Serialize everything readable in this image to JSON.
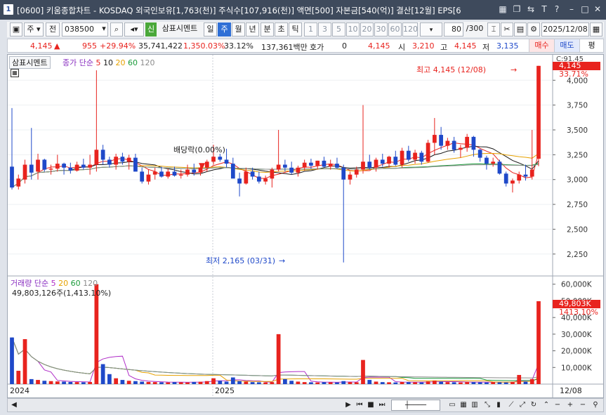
{
  "window": {
    "number": "1",
    "title": "[0600] 키움종합차트 - KOSDAQ 외국인보유[1,763(천)] 주식수[107,916(천)] 액면[500] 자본금[540(억)] 결산[12월] EPS[6"
  },
  "toolbar": {
    "market": "주",
    "prev": "전",
    "code": "038500",
    "credit": "신",
    "stock_name": "삼표시멘트",
    "periods": [
      "일",
      "주",
      "월",
      "년",
      "분",
      "초",
      "틱"
    ],
    "selected_period": "주",
    "intervals": [
      "1",
      "3",
      "5",
      "10",
      "20",
      "30",
      "60",
      "120"
    ],
    "count": "80",
    "total": "/300",
    "date": "2025/12/08"
  },
  "info": {
    "price": "4,145",
    "price_arrow": "▲",
    "change": "955",
    "change_pct": "+29.94%",
    "volume": "35,741,422",
    "volume_pct": "1,350.03%",
    "turnover": "33.12%",
    "amount": "137,361백만",
    "quote_label": "호가",
    "quote_value": "0",
    "quote_price": "4,145",
    "open_label": "시",
    "open": "3,210",
    "high_label": "고",
    "high": "4,145",
    "low_label": "저",
    "low": "3,135",
    "buy": "매수",
    "sell": "매도",
    "avg": "평"
  },
  "price_panel": {
    "name": "삼표시멘트",
    "ma_label": "종가 단순",
    "ma_periods": [
      "5",
      "10",
      "20",
      "60",
      "120"
    ],
    "ma_colors": [
      "#e8231e",
      "#1a1a1a",
      "#e6a100",
      "#1a9b3a",
      "#8c8c8c"
    ],
    "max_annotation": "최고 4,145 (12/08)",
    "min_annotation": "최저 2,165 (03/31)",
    "dividend_annotation": "배당락(0.00%)",
    "top_label": "C:91.45",
    "current_price": "4,145",
    "current_pct": "33.71%",
    "y_ticks": [
      "4,000",
      "3,750",
      "3,500",
      "3,250",
      "3,000",
      "2,750",
      "2,500",
      "2,250"
    ]
  },
  "volume_panel": {
    "name": "거래량",
    "ma_label": "단순",
    "ma_periods": [
      "5",
      "20",
      "60",
      "120"
    ],
    "ma_colors": [
      "#b02ec8",
      "#e6a100",
      "#1a9b3a",
      "#8c8c8c"
    ],
    "value_text": "49,803,126주(1,413.10%)",
    "current_value": "49,803K",
    "current_pct": "1413.10%",
    "y_ticks": [
      "60,000K",
      "50,000K",
      "40,000K",
      "30,000K",
      "20,000K",
      "10,000K"
    ]
  },
  "x_axis": {
    "labels": [
      "2024",
      "2025"
    ],
    "end_label": "12/08"
  },
  "chart_data": {
    "type": "candlestick",
    "x_labels": [
      "2024",
      "2025"
    ],
    "price_ylim": [
      2100,
      4200
    ],
    "volume_ylim": [
      0,
      62000
    ],
    "up_color": "#e8231e",
    "down_color": "#1f49c9",
    "candles": [
      [
        3130,
        3720,
        2900,
        2920
      ],
      [
        2930,
        3050,
        2900,
        3010
      ],
      [
        3000,
        3200,
        2960,
        3150
      ],
      [
        3150,
        3520,
        3000,
        3070
      ],
      [
        3080,
        3260,
        3000,
        3200
      ],
      [
        3200,
        3210,
        3080,
        3100
      ],
      [
        3100,
        3150,
        3050,
        3110
      ],
      [
        3110,
        3250,
        3080,
        3160
      ],
      [
        3160,
        3170,
        3050,
        3120
      ],
      [
        3120,
        3170,
        3060,
        3090
      ],
      [
        3090,
        3180,
        3080,
        3150
      ],
      [
        3150,
        3210,
        3100,
        3120
      ],
      [
        3120,
        3250,
        3050,
        3150
      ],
      [
        3150,
        4100,
        3080,
        3300
      ],
      [
        3300,
        3350,
        3150,
        3200
      ],
      [
        3200,
        3230,
        3120,
        3150
      ],
      [
        3150,
        3260,
        3100,
        3230
      ],
      [
        3230,
        3270,
        3150,
        3180
      ],
      [
        3180,
        3250,
        3100,
        3220
      ],
      [
        3220,
        3260,
        3150,
        3080
      ],
      [
        3080,
        3120,
        2960,
        2980
      ],
      [
        2980,
        3100,
        2950,
        3050
      ],
      [
        3050,
        3120,
        3000,
        3080
      ],
      [
        3080,
        3130,
        3020,
        3030
      ],
      [
        3030,
        3110,
        3010,
        3080
      ],
      [
        3080,
        3130,
        3030,
        3040
      ],
      [
        3040,
        3100,
        3010,
        3050
      ],
      [
        3050,
        3150,
        3030,
        3100
      ],
      [
        3100,
        3160,
        3040,
        3070
      ],
      [
        3070,
        3150,
        3040,
        3120
      ],
      [
        3120,
        3200,
        3080,
        3180
      ],
      [
        3180,
        3350,
        3150,
        3230
      ],
      [
        3230,
        3260,
        3180,
        3200
      ],
      [
        3200,
        3310,
        3120,
        3160
      ],
      [
        3160,
        3220,
        3070,
        3010
      ],
      [
        3010,
        3070,
        2830,
        2960
      ],
      [
        2960,
        3120,
        2950,
        3080
      ],
      [
        3080,
        3120,
        3000,
        3030
      ],
      [
        3030,
        3080,
        2960,
        2980
      ],
      [
        2980,
        3040,
        2950,
        3010
      ],
      [
        3010,
        3120,
        2920,
        3100
      ],
      [
        3100,
        3500,
        3080,
        3150
      ],
      [
        3150,
        3200,
        3080,
        3120
      ],
      [
        3120,
        3180,
        3050,
        3070
      ],
      [
        3070,
        3140,
        3030,
        3120
      ],
      [
        3120,
        3200,
        3090,
        3170
      ],
      [
        3170,
        3210,
        3110,
        3140
      ],
      [
        3140,
        3190,
        3100,
        3190
      ],
      [
        3190,
        3230,
        3120,
        3130
      ],
      [
        3130,
        3200,
        3100,
        3160
      ],
      [
        3160,
        3220,
        3110,
        3120
      ],
      [
        3120,
        3150,
        2165,
        3000
      ],
      [
        3000,
        3080,
        2950,
        3050
      ],
      [
        3050,
        3130,
        3020,
        3100
      ],
      [
        3100,
        3750,
        3060,
        3180
      ],
      [
        3180,
        3250,
        3100,
        3120
      ],
      [
        3120,
        3220,
        3080,
        3200
      ],
      [
        3200,
        3260,
        3130,
        3160
      ],
      [
        3160,
        3240,
        3120,
        3230
      ],
      [
        3230,
        3290,
        3140,
        3150
      ],
      [
        3150,
        3320,
        3120,
        3290
      ],
      [
        3290,
        3340,
        3180,
        3200
      ],
      [
        3200,
        3300,
        3160,
        3270
      ],
      [
        3270,
        3290,
        3150,
        3180
      ],
      [
        3180,
        3400,
        3170,
        3370
      ],
      [
        3370,
        3620,
        3250,
        3450
      ],
      [
        3450,
        3530,
        3300,
        3340
      ],
      [
        3340,
        3420,
        3300,
        3390
      ],
      [
        3390,
        3430,
        3270,
        3300
      ],
      [
        3300,
        3350,
        3220,
        3320
      ],
      [
        3320,
        3460,
        3280,
        3430
      ],
      [
        3430,
        3440,
        3230,
        3300
      ],
      [
        3300,
        3310,
        3180,
        3220
      ],
      [
        3220,
        3240,
        3100,
        3160
      ],
      [
        3160,
        3220,
        3130,
        3180
      ],
      [
        3180,
        3200,
        3050,
        3060
      ],
      [
        3060,
        3080,
        2930,
        2960
      ],
      [
        2960,
        3010,
        2870,
        2990
      ],
      [
        2990,
        3080,
        2960,
        3050
      ],
      [
        3050,
        3150,
        2990,
        3030
      ],
      [
        3030,
        3500,
        3000,
        3100
      ],
      [
        3210,
        4145,
        3135,
        4145
      ]
    ],
    "volumes": [
      28000,
      8000,
      27000,
      3000,
      2500,
      2000,
      1800,
      1600,
      1500,
      1300,
      1200,
      1100,
      1300,
      60000,
      12000,
      6000,
      3500,
      2500,
      2000,
      1800,
      1500,
      1300,
      1200,
      1100,
      1000,
      1200,
      1100,
      1000,
      1300,
      1400,
      1800,
      3500,
      2000,
      1500,
      4000,
      1800,
      1500,
      1200,
      1100,
      1000,
      1200,
      30000,
      3000,
      2000,
      1500,
      1200,
      1100,
      1000,
      1200,
      1100,
      1000,
      1800,
      1200,
      1100,
      14500,
      2500,
      1500,
      1200,
      1100,
      1000,
      1300,
      1200,
      1100,
      1000,
      1600,
      2000,
      1500,
      1200,
      1100,
      1000,
      1300,
      1200,
      1100,
      1000,
      1200,
      1100,
      1000,
      1300,
      5500,
      1500,
      3000,
      49803
    ]
  }
}
